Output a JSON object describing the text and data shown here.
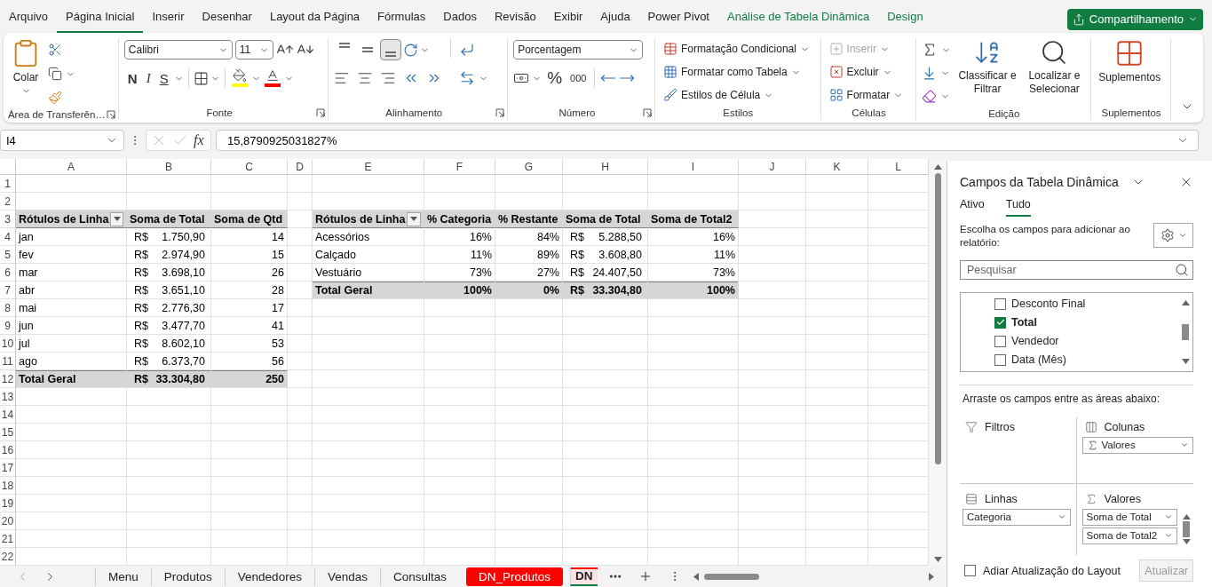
{
  "menu": {
    "tabs": [
      {
        "label": "Arquivo",
        "selected": false,
        "kind": "standard"
      },
      {
        "label": "Página Inicial",
        "selected": true,
        "kind": "standard"
      },
      {
        "label": "Inserir",
        "selected": false,
        "kind": "standard"
      },
      {
        "label": "Desenhar",
        "selected": false,
        "kind": "standard"
      },
      {
        "label": "Layout da Página",
        "selected": false,
        "kind": "standard"
      },
      {
        "label": "Fórmulas",
        "selected": false,
        "kind": "standard"
      },
      {
        "label": "Dados",
        "selected": false,
        "kind": "standard"
      },
      {
        "label": "Revisão",
        "selected": false,
        "kind": "standard"
      },
      {
        "label": "Exibir",
        "selected": false,
        "kind": "standard"
      },
      {
        "label": "Ajuda",
        "selected": false,
        "kind": "standard"
      },
      {
        "label": "Power Pivot",
        "selected": false,
        "kind": "standard"
      },
      {
        "label": "Análise de Tabela Dinâmica",
        "selected": false,
        "kind": "contextual"
      },
      {
        "label": "Design",
        "selected": false,
        "kind": "contextual"
      }
    ],
    "share": "Compartilhamento"
  },
  "ribbon": {
    "groups": [
      {
        "kind": "clipboard",
        "label": "Área de Transferên…",
        "launcher": true,
        "paste": "Colar"
      },
      {
        "kind": "font",
        "label": "Fonte",
        "launcher": true,
        "font": "Calibri",
        "size": "11",
        "styles": [
          {
            "label": "N",
            "kind": "bold"
          },
          {
            "label": "I",
            "kind": "italic"
          },
          {
            "label": "S",
            "kind": "underline"
          }
        ]
      },
      {
        "kind": "alignment",
        "label": "Alinhamento",
        "launcher": true,
        "vertical": [
          {
            "selected": false
          },
          {
            "selected": false
          },
          {
            "selected": true
          }
        ]
      },
      {
        "kind": "number",
        "label": "Número",
        "launcher": true,
        "format": "Porcentagem",
        "percent": "%",
        "thousands": "000"
      },
      {
        "kind": "styles",
        "label": "Estilos",
        "items": [
          {
            "label": "Formatação Condicional",
            "kind": "conditional"
          },
          {
            "label": "Formatar como Tabela",
            "kind": "table"
          },
          {
            "label": "Estilos de Célula",
            "kind": "cell"
          }
        ]
      },
      {
        "kind": "cells",
        "label": "Células",
        "items": [
          {
            "label": "Inserir",
            "kind": "insert",
            "disabled": true
          },
          {
            "label": "Excluir",
            "kind": "delete",
            "disabled": false
          },
          {
            "label": "Formatar",
            "kind": "format",
            "disabled": false
          }
        ]
      },
      {
        "kind": "editing",
        "label": "Edição",
        "sort": "Classificar e Filtrar",
        "find": "Localizar e Selecionar"
      },
      {
        "kind": "addins",
        "label": "Suplementos",
        "button": "Suplementos"
      }
    ]
  },
  "formula_bar": {
    "name_box": "I4",
    "fx": "fx",
    "formula": "15,8790925031827%"
  },
  "sheet": {
    "columns": [
      "A",
      "B",
      "C",
      "D",
      "E",
      "F",
      "G",
      "H",
      "I",
      "J",
      "K",
      "L"
    ],
    "rows": [
      {
        "number": "1"
      },
      {
        "number": "2"
      },
      {
        "number": "3",
        "cells": [
          {
            "text": "Rótulos de Linha",
            "kind": "head",
            "filter": true
          },
          {
            "text": "Soma de Total",
            "kind": "head"
          },
          {
            "text": "Soma de Qtd",
            "kind": "head"
          },
          {},
          {
            "text": "Rótulos de Linha",
            "kind": "head",
            "filter": true
          },
          {
            "text": "% Categoria",
            "kind": "head"
          },
          {
            "text": "% Restante",
            "kind": "head"
          },
          {
            "text": "Soma de Total",
            "kind": "head"
          },
          {
            "text": "Soma de Total2",
            "kind": "head"
          }
        ]
      },
      {
        "number": "4",
        "cells": [
          {
            "text": "jan",
            "kind": "body"
          },
          {
            "currency": "R$",
            "text": "1.750,90",
            "kind": "body"
          },
          {
            "text": "14",
            "kind": "body",
            "right_aligned": true
          },
          {},
          {
            "text": "Acessórios",
            "kind": "body"
          },
          {
            "text": "16%",
            "kind": "body",
            "right_aligned": true
          },
          {
            "text": "84%",
            "kind": "body",
            "right_aligned": true
          },
          {
            "currency": "R$",
            "text": "5.288,50",
            "kind": "body"
          },
          {
            "text": "16%",
            "kind": "body",
            "right_aligned": true
          }
        ]
      },
      {
        "number": "5",
        "cells": [
          {
            "text": "fev",
            "kind": "body"
          },
          {
            "currency": "R$",
            "text": "2.974,90",
            "kind": "body"
          },
          {
            "text": "15",
            "kind": "body",
            "right_aligned": true
          },
          {},
          {
            "text": "Calçado",
            "kind": "body"
          },
          {
            "text": "11%",
            "kind": "body",
            "right_aligned": true
          },
          {
            "text": "89%",
            "kind": "body",
            "right_aligned": true
          },
          {
            "currency": "R$",
            "text": "3.608,80",
            "kind": "body"
          },
          {
            "text": "11%",
            "kind": "body",
            "right_aligned": true
          }
        ]
      },
      {
        "number": "6",
        "cells": [
          {
            "text": "mar",
            "kind": "body"
          },
          {
            "currency": "R$",
            "text": "3.698,10",
            "kind": "body"
          },
          {
            "text": "26",
            "kind": "body",
            "right_aligned": true
          },
          {},
          {
            "text": "Vestuário",
            "kind": "body"
          },
          {
            "text": "73%",
            "kind": "body",
            "right_aligned": true
          },
          {
            "text": "27%",
            "kind": "body",
            "right_aligned": true
          },
          {
            "currency": "R$",
            "text": "24.407,50",
            "kind": "body"
          },
          {
            "text": "73%",
            "kind": "body",
            "right_aligned": true
          }
        ]
      },
      {
        "number": "7",
        "cells": [
          {
            "text": "abr",
            "kind": "body"
          },
          {
            "currency": "R$",
            "text": "3.651,10",
            "kind": "body"
          },
          {
            "text": "28",
            "kind": "body",
            "right_aligned": true
          },
          {},
          {
            "text": "Total Geral",
            "kind": "total"
          },
          {
            "text": "100%",
            "kind": "total",
            "right_aligned": true
          },
          {
            "text": "0%",
            "kind": "total",
            "right_aligned": true
          },
          {
            "currency": "R$",
            "text": "33.304,80",
            "kind": "total"
          },
          {
            "text": "100%",
            "kind": "total",
            "right_aligned": true
          }
        ]
      },
      {
        "number": "8",
        "cells": [
          {
            "text": "mai",
            "kind": "body"
          },
          {
            "currency": "R$",
            "text": "2.776,30",
            "kind": "body"
          },
          {
            "text": "17",
            "kind": "body",
            "right_aligned": true
          }
        ]
      },
      {
        "number": "9",
        "cells": [
          {
            "text": "jun",
            "kind": "body"
          },
          {
            "currency": "R$",
            "text": "3.477,70",
            "kind": "body"
          },
          {
            "text": "41",
            "kind": "body",
            "right_aligned": true
          }
        ]
      },
      {
        "number": "10",
        "cells": [
          {
            "text": "jul",
            "kind": "body"
          },
          {
            "currency": "R$",
            "text": "8.602,10",
            "kind": "body"
          },
          {
            "text": "53",
            "kind": "body",
            "right_aligned": true
          }
        ]
      },
      {
        "number": "11",
        "cells": [
          {
            "text": "ago",
            "kind": "body"
          },
          {
            "currency": "R$",
            "text": "6.373,70",
            "kind": "body"
          },
          {
            "text": "56",
            "kind": "body",
            "right_aligned": true
          }
        ]
      },
      {
        "number": "12",
        "cells": [
          {
            "text": "Total Geral",
            "kind": "total"
          },
          {
            "currency": "R$",
            "text": "33.304,80",
            "kind": "total"
          },
          {
            "text": "250",
            "kind": "total",
            "right_aligned": true
          }
        ]
      },
      {
        "number": "13"
      },
      {
        "number": "14"
      },
      {
        "number": "15"
      },
      {
        "number": "16"
      },
      {
        "number": "17"
      },
      {
        "number": "18"
      },
      {
        "number": "19"
      },
      {
        "number": "20"
      },
      {
        "number": "21"
      },
      {
        "number": "22"
      }
    ]
  },
  "sheet_tabs": [
    {
      "label": "Menu",
      "selected": false
    },
    {
      "label": "Produtos",
      "selected": false
    },
    {
      "label": "Vendedores",
      "selected": false
    },
    {
      "label": "Vendas",
      "selected": false
    },
    {
      "label": "Consultas",
      "selected": false
    },
    {
      "label": "DN_Produtos",
      "selected": false,
      "color": "#ff0000"
    },
    {
      "label": "DN",
      "selected": true,
      "color": "#ff0000"
    }
  ],
  "pivot_pane": {
    "title": "Campos da Tabela Dinâmica",
    "tabs": [
      {
        "label": "Ativo",
        "selected": false
      },
      {
        "label": "Tudo",
        "selected": true
      }
    ],
    "instruction": "Escolha os campos para adicionar ao relatório:",
    "search": {
      "placeholder": "Pesquisar"
    },
    "fields": [
      {
        "label": "Desconto Final",
        "checked": false
      },
      {
        "label": "Total",
        "checked": true
      },
      {
        "label": "Vendedor",
        "checked": false
      },
      {
        "label": "Data (Mês)",
        "checked": false
      }
    ],
    "drag_hint": "Arraste os campos entre as áreas abaixo:",
    "areas": [
      {
        "kind": "filters",
        "label": "Filtros"
      },
      {
        "kind": "columns",
        "label": "Colunas",
        "fields": [
          {
            "label": "Valores",
            "kind": "sigma"
          }
        ]
      },
      {
        "kind": "rows",
        "label": "Linhas",
        "fields": [
          {
            "label": "Categoria",
            "kind": "plain"
          }
        ]
      },
      {
        "kind": "values",
        "label": "Valores",
        "fields": [
          {
            "label": "Soma de Total",
            "kind": "plain"
          },
          {
            "label": "Soma de Total2",
            "kind": "plain"
          }
        ]
      }
    ],
    "defer": {
      "label": "Adiar Atualização do Layout",
      "checked": false
    },
    "update": {
      "label": "Atualizar",
      "disabled": true
    }
  }
}
